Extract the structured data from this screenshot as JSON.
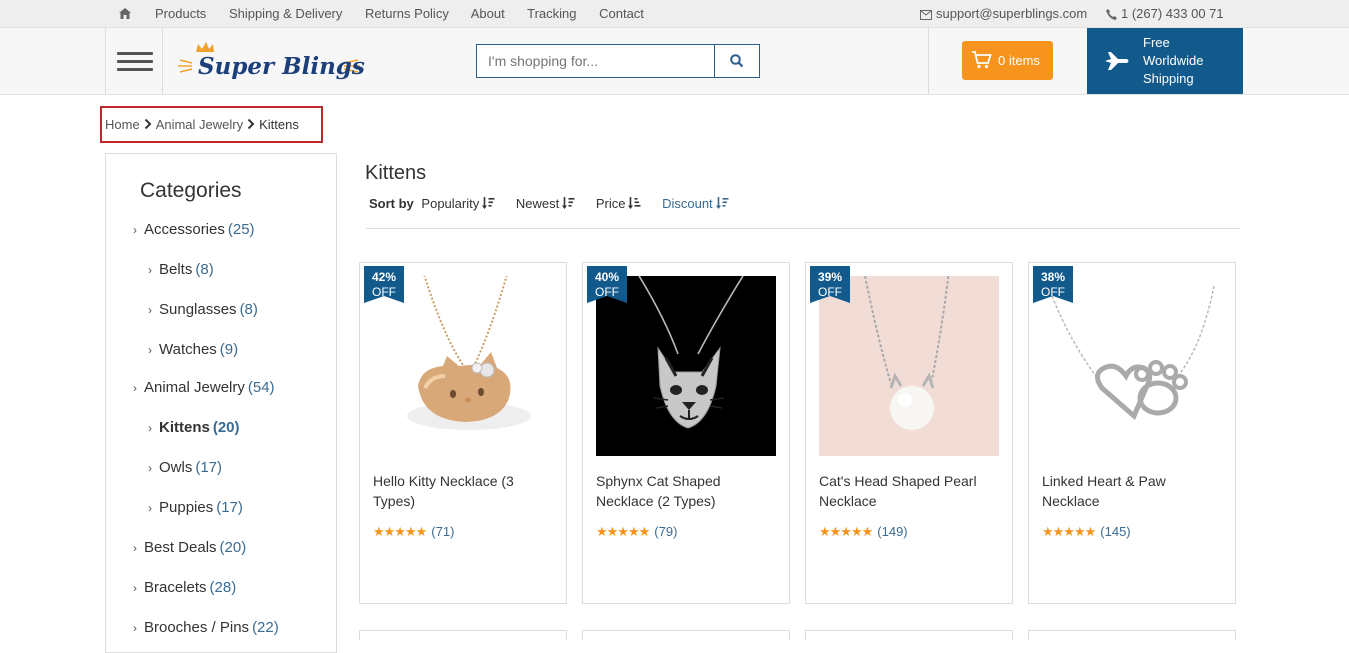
{
  "topbar": {
    "home_icon": "home-icon",
    "nav": [
      "Products",
      "Shipping & Delivery",
      "Returns Policy",
      "About",
      "Tracking",
      "Contact"
    ],
    "email": "support@superblings.com",
    "phone": "1 (267) 433 00 71"
  },
  "header": {
    "logo_text": "Super Blings",
    "search_placeholder": "I'm shopping for...",
    "cart_label": "0 items",
    "shipping_text": "Free Worldwide Shipping",
    "colors": {
      "cart": "#f7941d",
      "shipping": "#135a8c",
      "link": "#3a6b93"
    }
  },
  "breadcrumb": [
    "Home",
    "Animal Jewelry",
    "Kittens"
  ],
  "sidebar": {
    "title": "Categories",
    "items": [
      {
        "label": "Accessories",
        "count": "(25)",
        "level": 0
      },
      {
        "label": "Belts",
        "count": "(8)",
        "level": 1
      },
      {
        "label": "Sunglasses",
        "count": "(8)",
        "level": 1
      },
      {
        "label": "Watches",
        "count": "(9)",
        "level": 1
      },
      {
        "label": "Animal Jewelry",
        "count": "(54)",
        "level": 0
      },
      {
        "label": "Kittens",
        "count": "(20)",
        "level": 1,
        "active": true
      },
      {
        "label": "Owls",
        "count": "(17)",
        "level": 1
      },
      {
        "label": "Puppies",
        "count": "(17)",
        "level": 1
      },
      {
        "label": "Best Deals",
        "count": "(20)",
        "level": 0
      },
      {
        "label": "Bracelets",
        "count": "(28)",
        "level": 0
      },
      {
        "label": "Brooches / Pins",
        "count": "(22)",
        "level": 0
      }
    ]
  },
  "main": {
    "title": "Kittens",
    "sort_label": "Sort by",
    "sort_options": [
      "Popularity",
      "Newest",
      "Price",
      "Discount"
    ],
    "products": [
      {
        "discount": "42%",
        "off": "OFF",
        "name": "Hello Kitty Necklace (3 Types)",
        "reviews": "(71)",
        "rating": 5
      },
      {
        "discount": "40%",
        "off": "OFF",
        "name": "Sphynx Cat Shaped Necklace (2 Types)",
        "reviews": "(79)",
        "rating": 5
      },
      {
        "discount": "39%",
        "off": "OFF",
        "name": "Cat's Head Shaped Pearl Necklace",
        "reviews": "(149)",
        "rating": 5
      },
      {
        "discount": "38%",
        "off": "OFF",
        "name": "Linked Heart & Paw Necklace",
        "reviews": "(145)",
        "rating": 5
      }
    ]
  }
}
